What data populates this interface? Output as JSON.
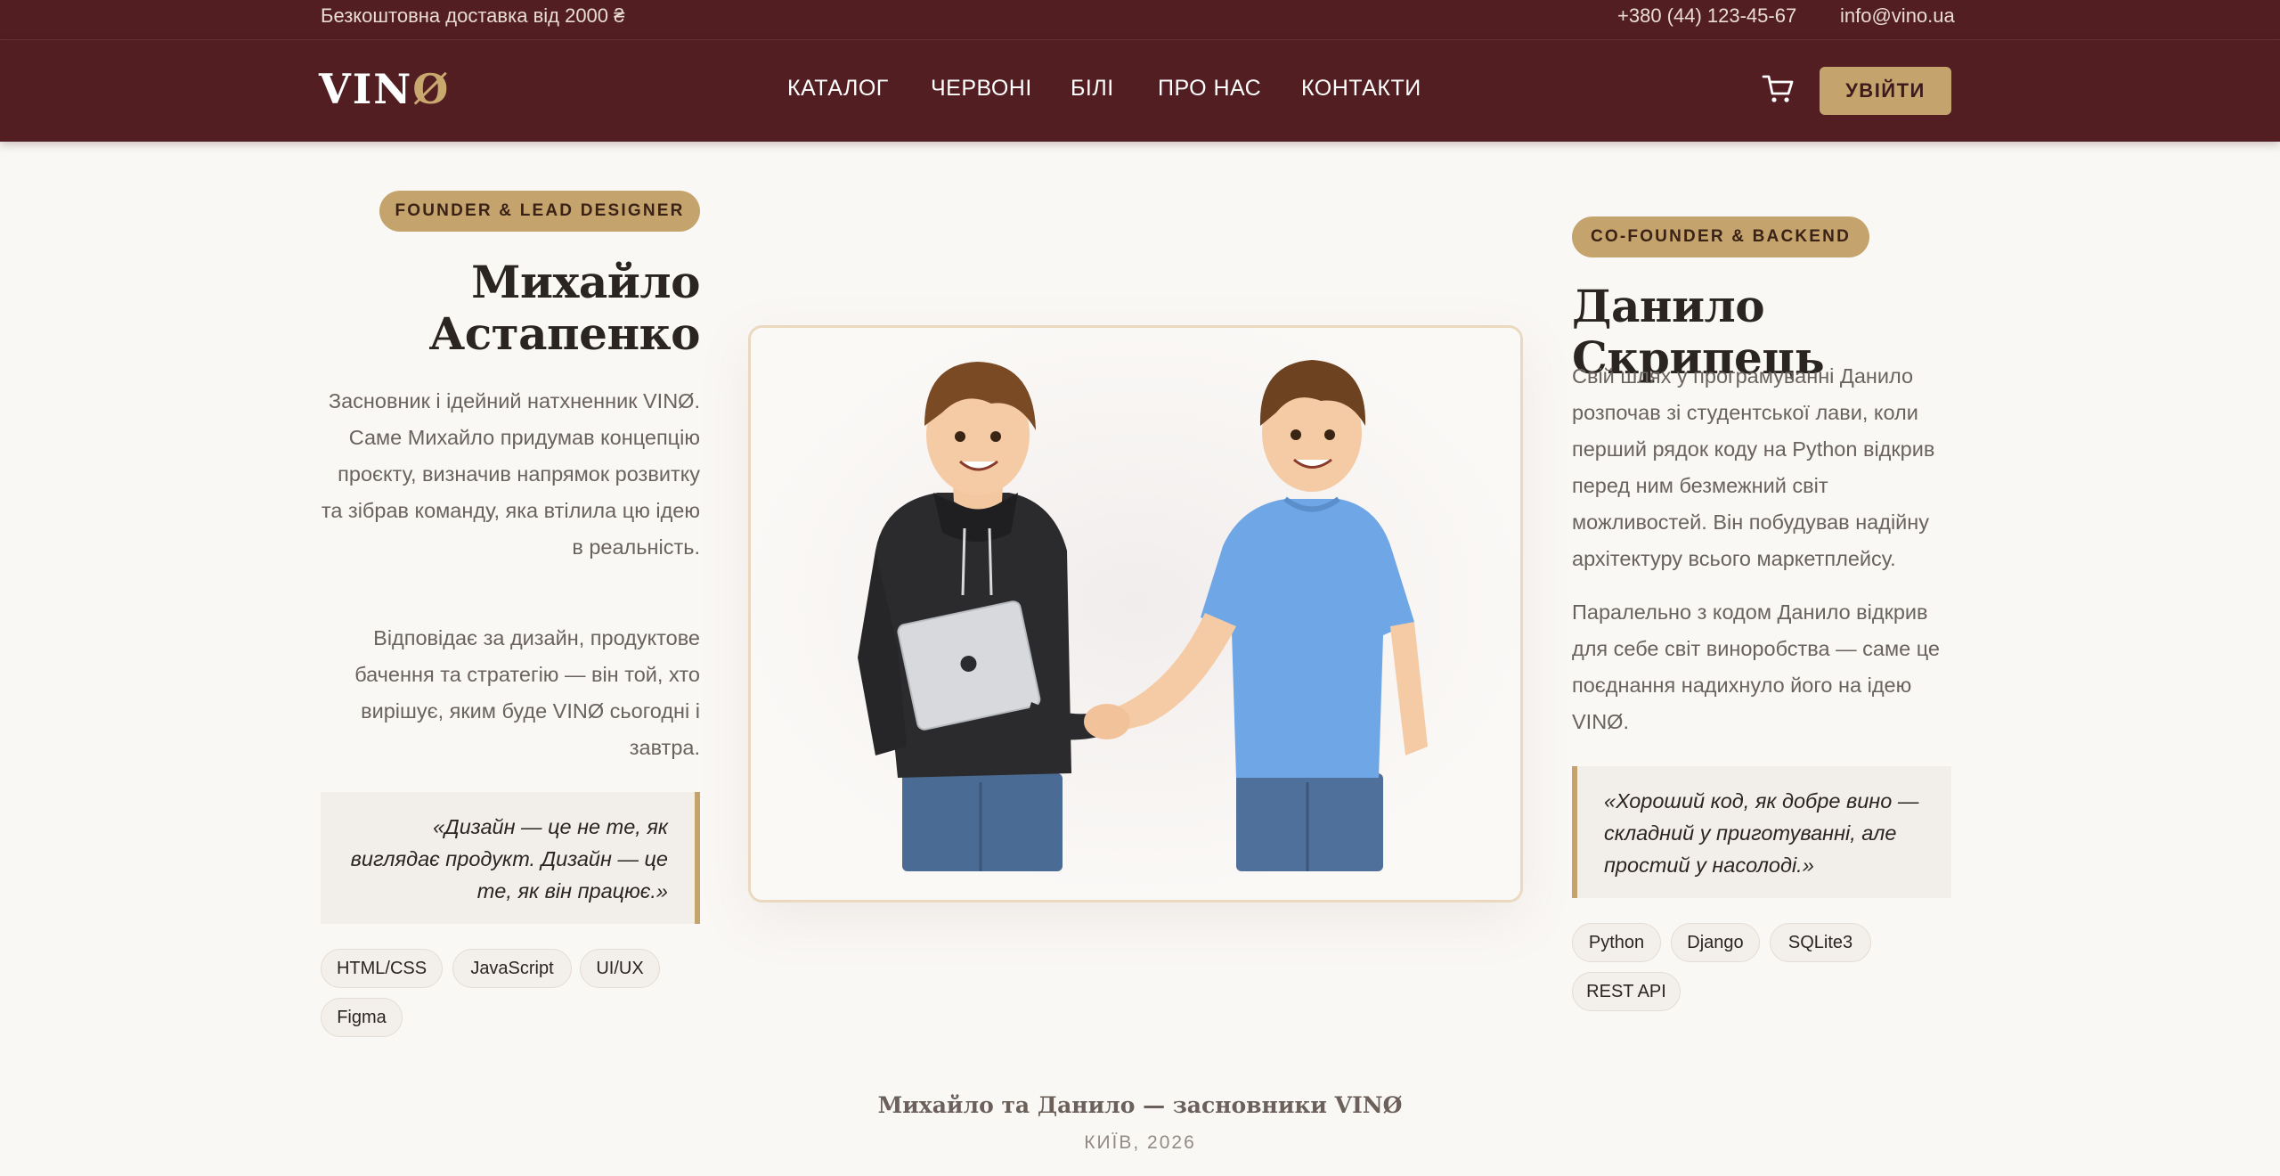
{
  "topbar": {
    "shipping": "Безкоштовна доставка від 2000 ₴",
    "phone": "+380 (44) 123-45-67",
    "email": "info@vino.ua"
  },
  "nav": {
    "logo_main": "VIN",
    "logo_accent": "Ø",
    "items": [
      "КАТАЛОГ",
      "ЧЕРВОНІ",
      "БІЛІ",
      "ПРО НАС",
      "КОНТАКТИ"
    ],
    "cart_icon": "cart-icon",
    "login": "УВІЙТИ"
  },
  "colors": {
    "header_bg": "#521e22",
    "accent_gold": "#c4a36d",
    "page_bg": "#faf8f5"
  },
  "founder1": {
    "role": "FOUNDER & LEAD DESIGNER",
    "name_line1": "Михайло",
    "name_line2": "Астапенко",
    "bio1": "Засновник і ідейний натхненник VINØ. Саме Михайло придумав концепцію проєкту, визначив напрямок розвитку та зібрав команду, яка втілила цю ідею в реальність.",
    "bio2": "Відповідає за дизайн, продуктове бачення та стратегію — він той, хто вирішує, яким буде VINØ сьогодні і завтра.",
    "quote": "«Дизайн — це не те, як виглядає продукт. Дизайн — це те, як він працює.»",
    "skills": [
      "HTML/CSS",
      "JavaScript",
      "UI/UX",
      "Figma"
    ]
  },
  "founder2": {
    "role": "CO-FOUNDER & BACKEND",
    "name": "Данило Скрипець",
    "bio1": "Свій шлях у програмуванні Данило розпочав зі студентської лави, коли перший рядок коду на Python відкрив перед ним безмежний світ можливостей. Він побудував надійну архітектуру всього маркетплейсу.",
    "bio2": "Паралельно з кодом Данило відкрив для себе світ виноробства — саме це поєднання надихнуло його на ідею VINØ.",
    "quote": "«Хороший код, як добре вино — складний у приготуванні, але простий у насолоді.»",
    "skills": [
      "Python",
      "Django",
      "SQLite3",
      "REST API"
    ]
  },
  "caption": {
    "title": "Михайло та Данило — засновники VINØ",
    "place": "КИЇВ, 2026"
  }
}
